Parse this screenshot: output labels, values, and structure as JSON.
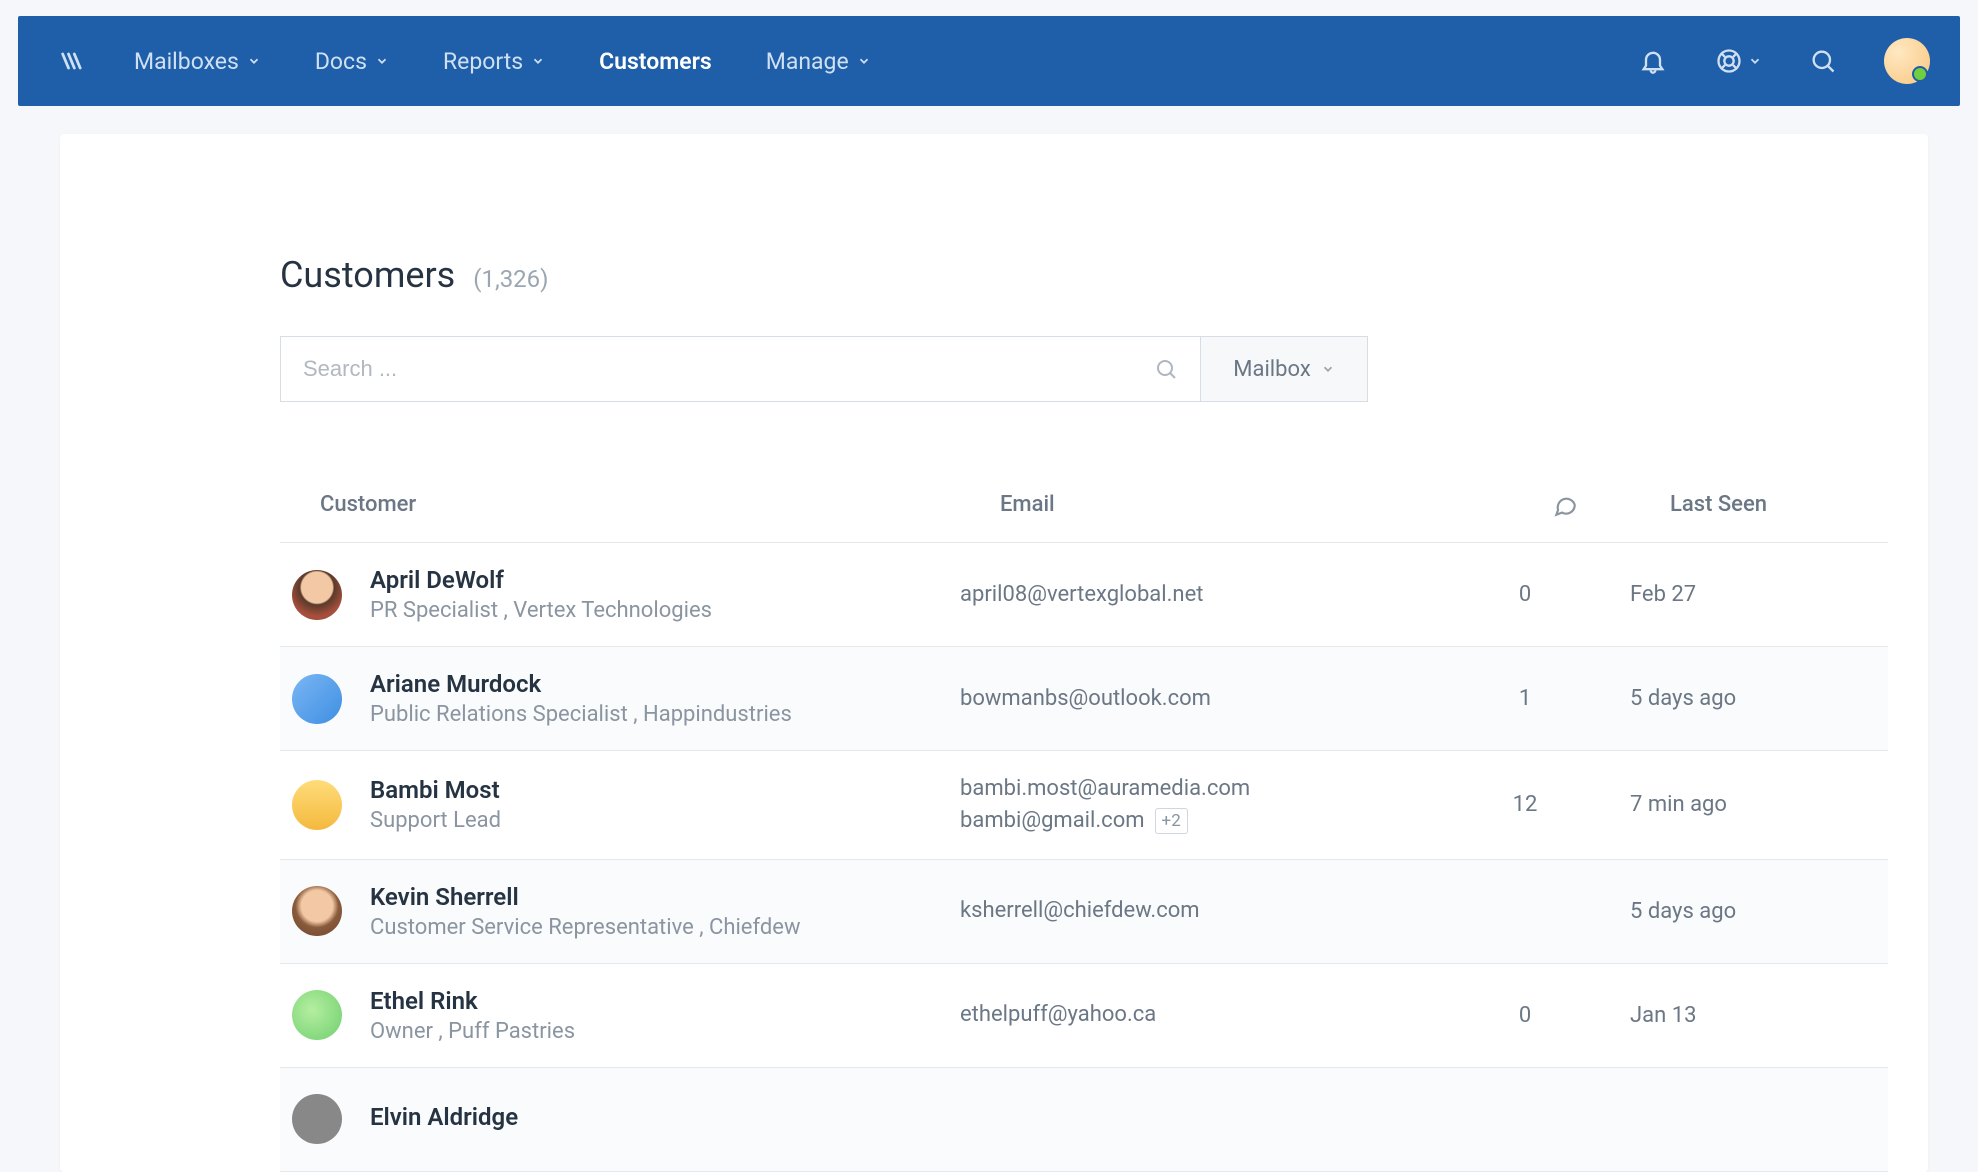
{
  "nav": {
    "items": [
      {
        "label": "Mailboxes",
        "dropdown": true,
        "active": false
      },
      {
        "label": "Docs",
        "dropdown": true,
        "active": false
      },
      {
        "label": "Reports",
        "dropdown": true,
        "active": false
      },
      {
        "label": "Customers",
        "dropdown": false,
        "active": true
      },
      {
        "label": "Manage",
        "dropdown": true,
        "active": false
      }
    ]
  },
  "page": {
    "title": "Customers",
    "count_label": "(1,326)"
  },
  "search": {
    "placeholder": "Search ...",
    "filter_label": "Mailbox"
  },
  "columns": {
    "customer": "Customer",
    "email": "Email",
    "last_seen": "Last Seen"
  },
  "customers": [
    {
      "name": "April DeWolf",
      "subtitle": "PR Specialist , Vertex Technologies",
      "emails": [
        "april08@vertexglobal.net"
      ],
      "extra_emails": null,
      "conversations": "0",
      "last_seen": "Feb 27",
      "avatar": "av-face1",
      "alt": false
    },
    {
      "name": "Ariane Murdock",
      "subtitle": "Public Relations Specialist , Happindustries",
      "emails": [
        "bowmanbs@outlook.com"
      ],
      "extra_emails": null,
      "conversations": "1",
      "last_seen": "5 days ago",
      "avatar": "av-blue",
      "alt": true
    },
    {
      "name": "Bambi Most",
      "subtitle": "Support Lead",
      "emails": [
        "bambi.most@auramedia.com",
        "bambi@gmail.com"
      ],
      "extra_emails": "+2",
      "conversations": "12",
      "last_seen": "7 min ago",
      "avatar": "av-yellow",
      "alt": false
    },
    {
      "name": "Kevin Sherrell",
      "subtitle": "Customer Service Representative , Chiefdew",
      "emails": [
        "ksherrell@chiefdew.com"
      ],
      "extra_emails": null,
      "conversations": "",
      "last_seen": "5 days ago",
      "avatar": "av-face2",
      "alt": true
    },
    {
      "name": "Ethel Rink",
      "subtitle": "Owner , Puff Pastries",
      "emails": [
        "ethelpuff@yahoo.ca"
      ],
      "extra_emails": null,
      "conversations": "0",
      "last_seen": "Jan 13",
      "avatar": "av-green",
      "alt": false
    },
    {
      "name": "Elvin Aldridge",
      "subtitle": "",
      "emails": [],
      "extra_emails": null,
      "conversations": "",
      "last_seen": "",
      "avatar": "av-gray",
      "alt": true
    }
  ]
}
